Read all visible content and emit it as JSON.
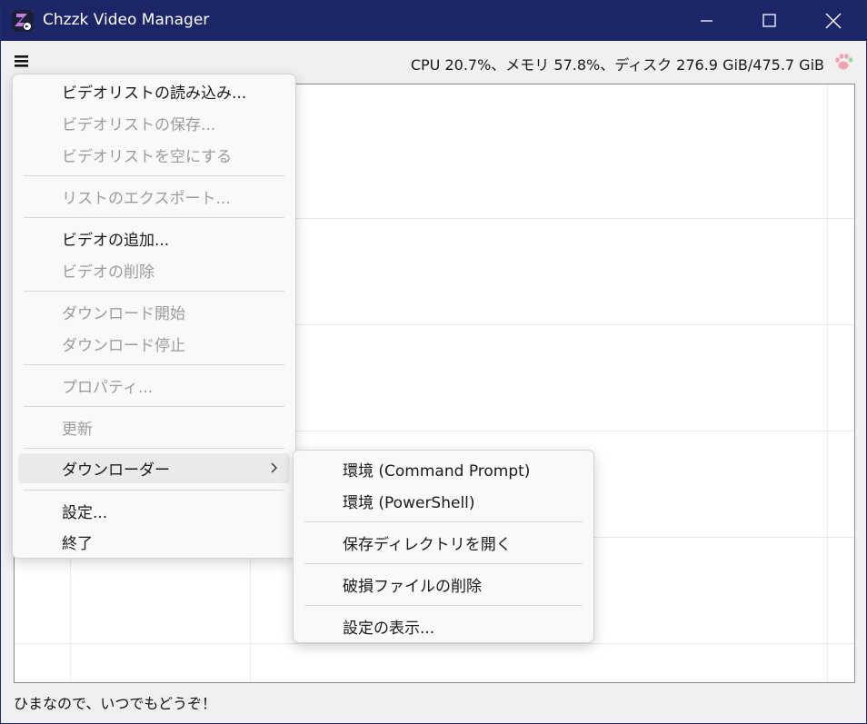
{
  "window": {
    "title": "Chzzk Video Manager",
    "icon": "chzzk-app-icon",
    "controls": [
      "minimize-icon",
      "maximize-icon",
      "close-icon"
    ],
    "title_bar_color": "#1b2568"
  },
  "toolbar": {
    "menu_icon": "hamburger-menu-icon",
    "status": "CPU 20.7%、メモリ 57.8%、ディスク 276.9 GiB/475.7 GiB",
    "paw_icon": "paw-icon"
  },
  "main_menu": {
    "items": [
      {
        "label": "ビデオリストの読み込み...",
        "enabled": true
      },
      {
        "label": "ビデオリストの保存...",
        "enabled": false
      },
      {
        "label": "ビデオリストを空にする",
        "enabled": false
      },
      {
        "label": "リストのエクスポート...",
        "enabled": false
      },
      {
        "label": "ビデオの追加...",
        "enabled": true
      },
      {
        "label": "ビデオの削除",
        "enabled": false
      },
      {
        "label": "ダウンロード開始",
        "enabled": false
      },
      {
        "label": "ダウンロード停止",
        "enabled": false
      },
      {
        "label": "プロパティ...",
        "enabled": false
      },
      {
        "label": "更新",
        "enabled": false
      },
      {
        "label": "ダウンローダー",
        "enabled": true,
        "submenu": true
      },
      {
        "label": "設定...",
        "enabled": true
      },
      {
        "label": "終了",
        "enabled": true
      }
    ]
  },
  "downloader_submenu": {
    "items": [
      {
        "label": "環境 (Command Prompt)"
      },
      {
        "label": "環境 (PowerShell)"
      },
      {
        "label": "保存ディレクトリを開く"
      },
      {
        "label": "破損ファイルの削除"
      },
      {
        "label": "設定の表示..."
      }
    ]
  },
  "footer": {
    "message": "ひまなので、いつでもどうぞ！"
  },
  "colors": {
    "accent": "#1b2568",
    "disabled_text": "#9c9c9c",
    "paw": "#f2a3b3"
  }
}
